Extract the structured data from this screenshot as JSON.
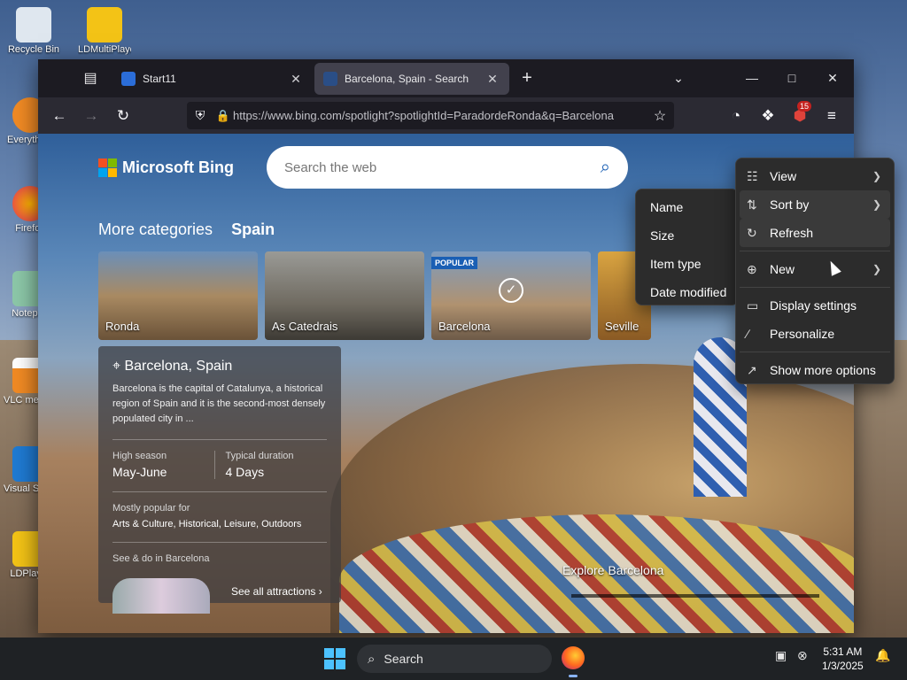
{
  "desktop": {
    "icons": [
      {
        "label": "Recycle Bin"
      },
      {
        "label": "LDMultiPlayer"
      },
      {
        "label": "Everything"
      },
      {
        "label": "Firefox"
      },
      {
        "label": "Notepad"
      },
      {
        "label": "VLC media player"
      },
      {
        "label": "Visual Studio Code"
      },
      {
        "label": "LDPlayer"
      }
    ]
  },
  "browser": {
    "tabs": [
      {
        "title": "Start11",
        "active": false
      },
      {
        "title": "Barcelona, Spain - Search",
        "active": true
      }
    ],
    "url": "https://www.bing.com/spotlight?spotlightId=ParadordeRonda&q=Barcelona",
    "extension_badge": "15"
  },
  "bing": {
    "logo_text": "Microsoft Bing",
    "search_placeholder": "Search the web",
    "categories_label": "More categories",
    "categories_current": "Spain",
    "cards": [
      {
        "label": "Ronda",
        "badge": "",
        "selected": false
      },
      {
        "label": "As Catedrais",
        "badge": "",
        "selected": false
      },
      {
        "label": "Barcelona",
        "badge": "POPULAR",
        "selected": true
      },
      {
        "label": "Seville",
        "badge": "",
        "selected": false
      }
    ],
    "info": {
      "title": "Barcelona, Spain",
      "description": "Barcelona is the capital of Catalunya, a historical region of Spain and it is the second-most densely populated city in ...",
      "high_season_label": "High season",
      "high_season_value": "May-June",
      "duration_label": "Typical duration",
      "duration_value": "4 Days",
      "popular_label": "Mostly popular for",
      "popular_value": "Arts & Culture, Historical, Leisure, Outdoors",
      "see_do_label": "See & do in Barcelona",
      "see_all": "See all attractions"
    },
    "explore": "Explore Barcelona"
  },
  "context_menu": {
    "items": [
      {
        "label": "View",
        "icon": "grid-icon",
        "submenu": true
      },
      {
        "label": "Sort by",
        "icon": "sort-icon",
        "submenu": true
      },
      {
        "label": "Refresh",
        "icon": "refresh-icon",
        "submenu": false
      },
      {
        "label": "New",
        "icon": "plus-circle-icon",
        "submenu": true
      },
      {
        "label": "Display settings",
        "icon": "display-icon",
        "submenu": false
      },
      {
        "label": "Personalize",
        "icon": "brush-icon",
        "submenu": false
      },
      {
        "label": "Show more options",
        "icon": "open-external-icon",
        "submenu": false
      }
    ],
    "sort_submenu": [
      "Name",
      "Size",
      "Item type",
      "Date modified"
    ]
  },
  "taskbar": {
    "search_label": "Search",
    "time": "5:31 AM",
    "date": "1/3/2025"
  },
  "colors": {
    "accent": "#1a5fb4",
    "start_icon": "#4cc2ff"
  }
}
